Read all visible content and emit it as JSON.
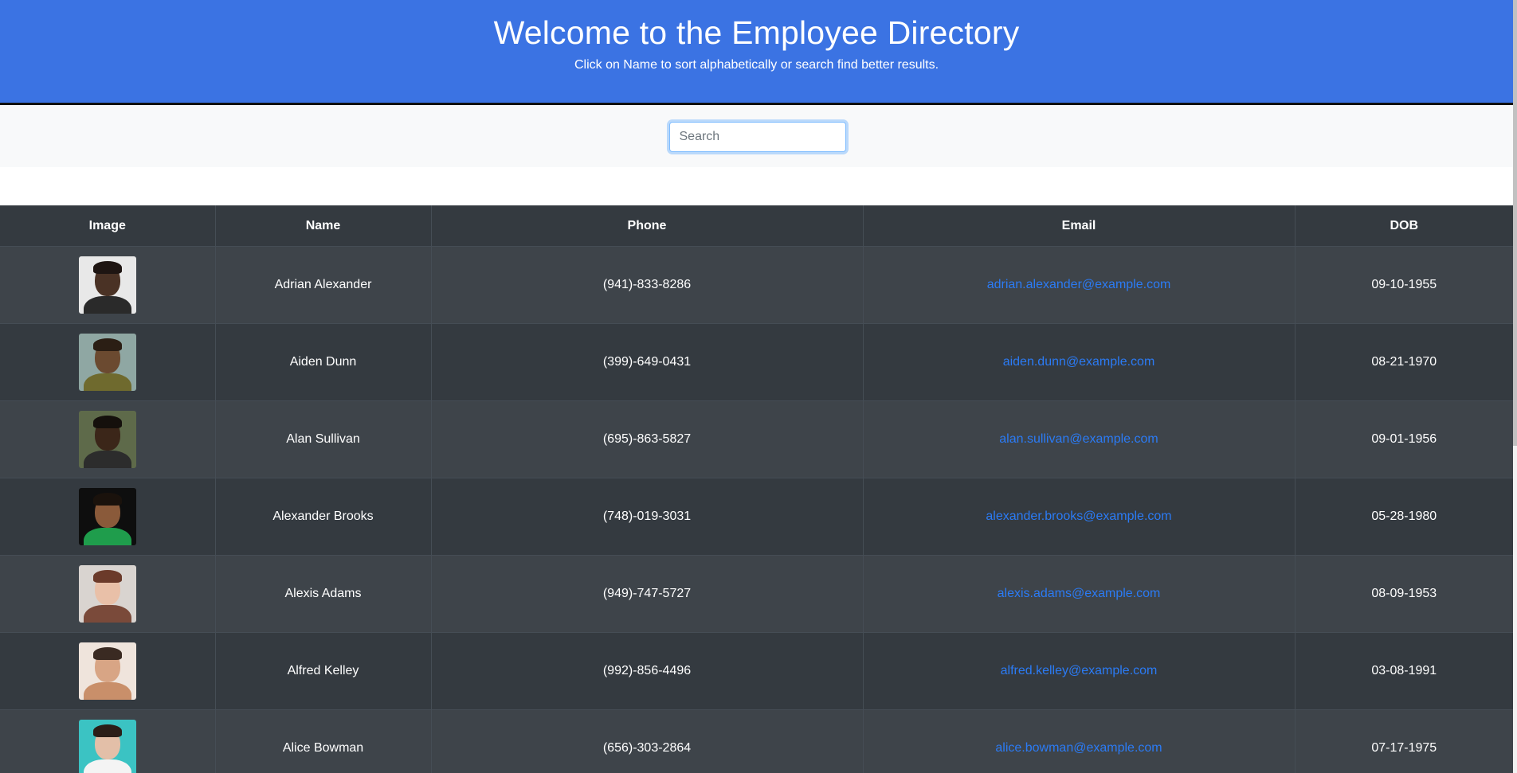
{
  "header": {
    "title": "Welcome to the Employee Directory",
    "subtitle": "Click on Name to sort alphabetically or search find better results."
  },
  "search": {
    "placeholder": "Search",
    "value": ""
  },
  "table": {
    "columns": [
      "Image",
      "Name",
      "Phone",
      "Email",
      "DOB"
    ],
    "rows": [
      {
        "name": "Adrian Alexander",
        "phone": "(941)-833-8286",
        "email": "adrian.alexander@example.com",
        "dob": "09-10-1955",
        "avatar": {
          "bg": "#e8e8e8",
          "skin": "#4a3225",
          "hair": "#1e1512",
          "shirt": "#2a2a2a"
        }
      },
      {
        "name": "Aiden Dunn",
        "phone": "(399)-649-0431",
        "email": "aiden.dunn@example.com",
        "dob": "08-21-1970",
        "avatar": {
          "bg": "#8fa7a3",
          "skin": "#6b4a30",
          "hair": "#2b1e14",
          "shirt": "#6f6a2e"
        }
      },
      {
        "name": "Alan Sullivan",
        "phone": "(695)-863-5827",
        "email": "alan.sullivan@example.com",
        "dob": "09-01-1956",
        "avatar": {
          "bg": "#5e6a4a",
          "skin": "#3b2619",
          "hair": "#15100c",
          "shirt": "#2c2c2c"
        }
      },
      {
        "name": "Alexander Brooks",
        "phone": "(748)-019-3031",
        "email": "alexander.brooks@example.com",
        "dob": "05-28-1980",
        "avatar": {
          "bg": "#0e0e0e",
          "skin": "#8a5a3a",
          "hair": "#1a120c",
          "shirt": "#1f9d4c"
        }
      },
      {
        "name": "Alexis Adams",
        "phone": "(949)-747-5727",
        "email": "alexis.adams@example.com",
        "dob": "08-09-1953",
        "avatar": {
          "bg": "#d9d4d0",
          "skin": "#e9c0a8",
          "hair": "#6b3a2a",
          "shirt": "#7a4a3a"
        }
      },
      {
        "name": "Alfred Kelley",
        "phone": "(992)-856-4496",
        "email": "alfred.kelley@example.com",
        "dob": "03-08-1991",
        "avatar": {
          "bg": "#efe4dc",
          "skin": "#d8a585",
          "hair": "#3a2a22",
          "shirt": "#c98f6a"
        }
      },
      {
        "name": "Alice Bowman",
        "phone": "(656)-303-2864",
        "email": "alice.bowman@example.com",
        "dob": "07-17-1975",
        "avatar": {
          "bg": "#3bc3c3",
          "skin": "#e3bfa8",
          "hair": "#2b1e18",
          "shirt": "#f4f4f4"
        }
      }
    ]
  }
}
